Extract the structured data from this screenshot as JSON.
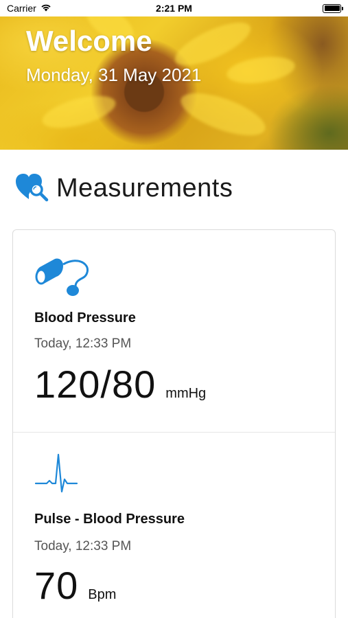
{
  "status_bar": {
    "carrier": "Carrier",
    "time": "2:21 PM"
  },
  "hero": {
    "title": "Welcome",
    "date": "Monday, 31 May 2021"
  },
  "section": {
    "title": "Measurements",
    "icon": "heart-search-icon"
  },
  "measurements": [
    {
      "icon": "blood-pressure-cuff-icon",
      "title": "Blood Pressure",
      "time": "Today, 12:33 PM",
      "value": "120/80",
      "unit": "mmHg"
    },
    {
      "icon": "pulse-waveform-icon",
      "title": "Pulse - Blood Pressure",
      "time": "Today, 12:33 PM",
      "value": "70",
      "unit": "Bpm"
    }
  ],
  "colors": {
    "accent": "#1e88d8",
    "text_primary": "#111111",
    "text_secondary": "#555555",
    "card_border": "#dcdcdc"
  }
}
